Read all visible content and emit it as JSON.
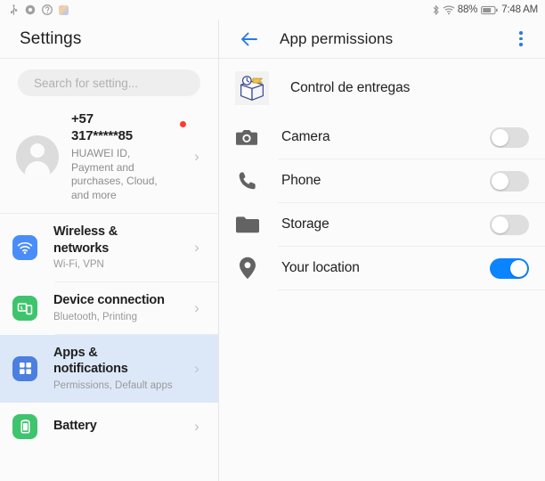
{
  "statusbar": {
    "left_icons": [
      "usb-icon",
      "settings-gear-icon",
      "help-circle-icon",
      "app-notification-icon"
    ],
    "bluetooth_icon": "bluetooth-icon",
    "wifi_icon": "wifi-icon",
    "battery_percent": "88%",
    "battery_icon": "battery-icon",
    "time": "7:48 AM"
  },
  "sidebar": {
    "title": "Settings",
    "search": {
      "placeholder": "Search for setting..."
    },
    "account": {
      "name_line1": "+57",
      "name_line2": "317*****85",
      "subtitle": "HUAWEI ID, Payment and purchases, Cloud, and more",
      "chevron": "›",
      "badge": "notification-dot",
      "badge_color": "#ff3b30"
    },
    "items": [
      {
        "label": "Wireless & networks",
        "subtitle": "Wi-Fi, VPN",
        "icon": "wifi-icon",
        "icon_color": "#4b8df8",
        "selected": false,
        "chevron": "›"
      },
      {
        "label": "Device connection",
        "subtitle": "Bluetooth, Printing",
        "icon": "device-connection-icon",
        "icon_color": "#3ec46d",
        "selected": false,
        "chevron": "›"
      },
      {
        "label": "Apps & notifications",
        "subtitle": "Permissions, Default apps",
        "icon": "apps-grid-icon",
        "icon_color": "#4b7fe0",
        "selected": true,
        "chevron": "›"
      },
      {
        "label": "Battery",
        "subtitle": "",
        "icon": "battery-icon",
        "icon_color": "#3ec46d",
        "selected": false,
        "chevron": "›"
      }
    ],
    "selected_bg": "#dce8f8"
  },
  "detail": {
    "back_icon": "back-arrow-icon",
    "title": "App permissions",
    "overflow_icon": "more-vertical-icon",
    "accent_color": "#2979e8",
    "app": {
      "name": "Control de entregas",
      "icon": "delivery-box-icon"
    },
    "permissions": [
      {
        "label": "Camera",
        "icon": "camera-icon",
        "enabled": false
      },
      {
        "label": "Phone",
        "icon": "phone-icon",
        "enabled": false
      },
      {
        "label": "Storage",
        "icon": "folder-icon",
        "enabled": false
      },
      {
        "label": "Your location",
        "icon": "location-pin-icon",
        "enabled": true
      }
    ],
    "toggle_on_color": "#0b84ff",
    "toggle_off_color": "#dedede"
  }
}
